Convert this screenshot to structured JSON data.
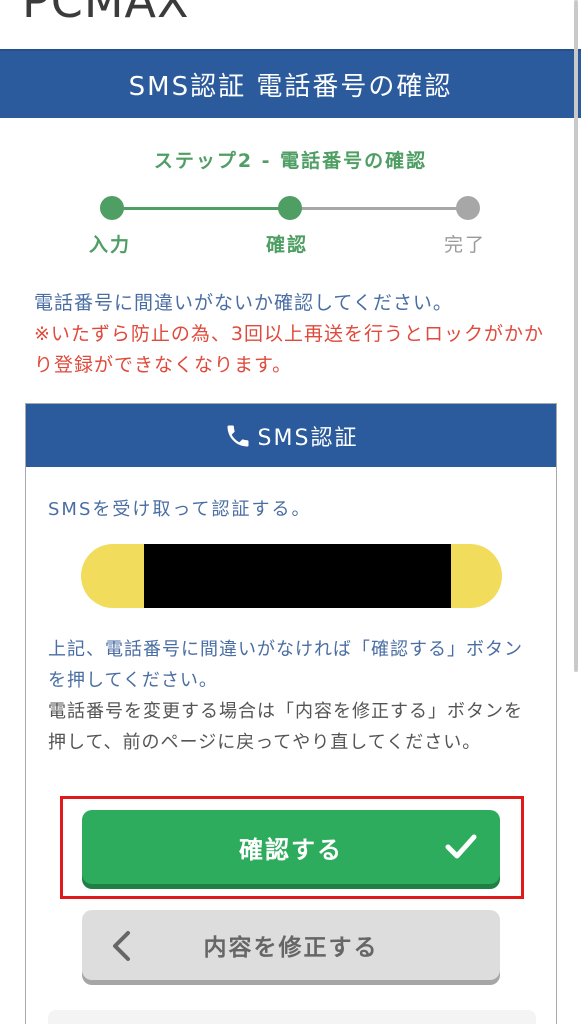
{
  "logo": {
    "text": "PCMAX"
  },
  "header": {
    "title": "SMS認証 電話番号の確認"
  },
  "steps": {
    "title": "ステップ2 - 電話番号の確認",
    "items": [
      {
        "label": "入力",
        "state": "done"
      },
      {
        "label": "確認",
        "state": "current"
      },
      {
        "label": "完了",
        "state": "todo"
      }
    ]
  },
  "notice": {
    "line1": "電話番号に間違いがないか確認してください。",
    "line2": "※いたずら防止の為、3回以上再送を行うとロックがかかり登録ができなくなります。"
  },
  "card": {
    "title": "SMS認証",
    "lead": "SMSを受け取って認証する。",
    "instruction": "上記、電話番号に間違いがなければ「確認する」ボタンを押してください。",
    "help": "電話番号を変更する場合は「内容を修正する」ボタンを押して、前のページに戻ってやり直してください。"
  },
  "buttons": {
    "confirm": "確認する",
    "modify": "内容を修正する"
  },
  "colors": {
    "header": "#2b5b9c",
    "step_green": "#4f9e64",
    "warning_red": "#e04a3c",
    "confirm_green": "#2eac5e",
    "highlight_red": "#e01a1a",
    "phone_pill": "#f1dc5c"
  },
  "icons": {
    "card_header": "phone-icon",
    "confirm": "check-icon",
    "modify": "chevron-left-icon"
  }
}
